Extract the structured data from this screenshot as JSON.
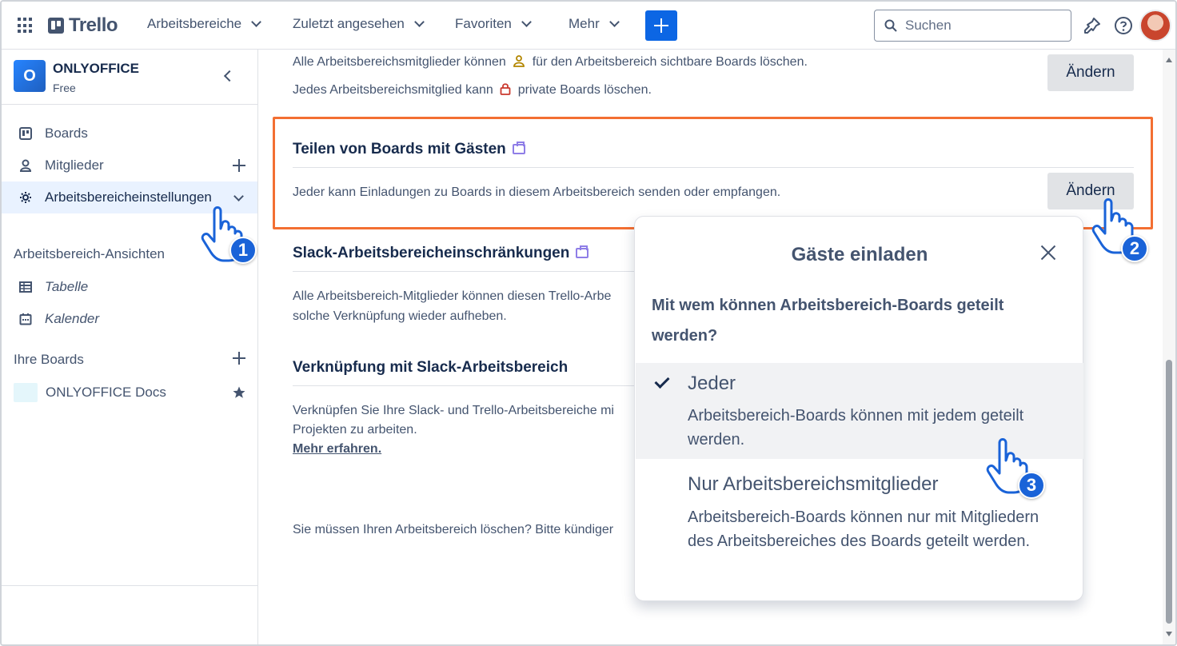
{
  "header": {
    "logo": "Trello",
    "nav": [
      {
        "label": "Arbeitsbereiche"
      },
      {
        "label": "Zuletzt angesehen"
      },
      {
        "label": "Favoriten"
      },
      {
        "label": "Mehr"
      }
    ],
    "search_placeholder": "Suchen"
  },
  "sidebar": {
    "workspace_initial": "O",
    "workspace_name": "ONLYOFFICE",
    "workspace_plan": "Free",
    "items": [
      {
        "label": "Boards"
      },
      {
        "label": "Mitglieder"
      },
      {
        "label": "Arbeitsbereicheinstellungen"
      }
    ],
    "views_heading": "Arbeitsbereich-Ansichten",
    "views": [
      {
        "label": "Tabelle"
      },
      {
        "label": "Kalender"
      }
    ],
    "boards_heading": "Ihre Boards",
    "boards": [
      {
        "label": "ONLYOFFICE Docs"
      }
    ]
  },
  "main": {
    "deletion_line1_pre": "Alle Arbeitsbereichsmitglieder können",
    "deletion_line1_post": "für den Arbeitsbereich sichtbare Boards löschen.",
    "deletion_line2_pre": "Jedes Arbeitsbereichsmitglied kann",
    "deletion_line2_post": "private Boards löschen.",
    "change_label": "Ändern",
    "guest_sharing_title": "Teilen von Boards mit Gästen",
    "guest_sharing_desc": "Jeder kann Einladungen zu Boards in diesem Arbeitsbereich senden oder empfangen.",
    "slack_restrictions_title": "Slack-Arbeitsbereicheinschränkungen",
    "slack_restrictions_line1": "Alle Arbeitsbereich-Mitglieder können diesen Trello-Arbe",
    "slack_restrictions_line2": "solche Verknüpfung wieder aufheben.",
    "slack_link_title": "Verknüpfung mit Slack-Arbeitsbereich",
    "slack_link_line1": "Verknüpfen Sie Ihre Slack- und Trello-Arbeitsbereiche mi",
    "slack_link_line2": "Projekten zu arbeiten.",
    "learn_more": "Mehr erfahren.",
    "delete_ws_text": "Sie müssen Ihren Arbeitsbereich löschen? Bitte kündiger"
  },
  "popover": {
    "title": "Gäste einladen",
    "question": "Mit wem können Arbeitsbereich-Boards geteilt werden?",
    "options": [
      {
        "title": "Jeder",
        "desc": "Arbeitsbereich-Boards können mit jedem geteilt werden.",
        "selected": true
      },
      {
        "title": "Nur Arbeitsbereichsmitglieder",
        "desc": "Arbeitsbereich-Boards können nur mit Mitgliedern des Arbeitsbereiches des Boards geteilt werden.",
        "selected": false
      }
    ]
  },
  "annotations": {
    "step1": "1",
    "step2": "2",
    "step3": "3"
  },
  "colors": {
    "accent": "#0c66e4",
    "highlight_border": "#f36f32",
    "badge": "#1a63d8"
  }
}
